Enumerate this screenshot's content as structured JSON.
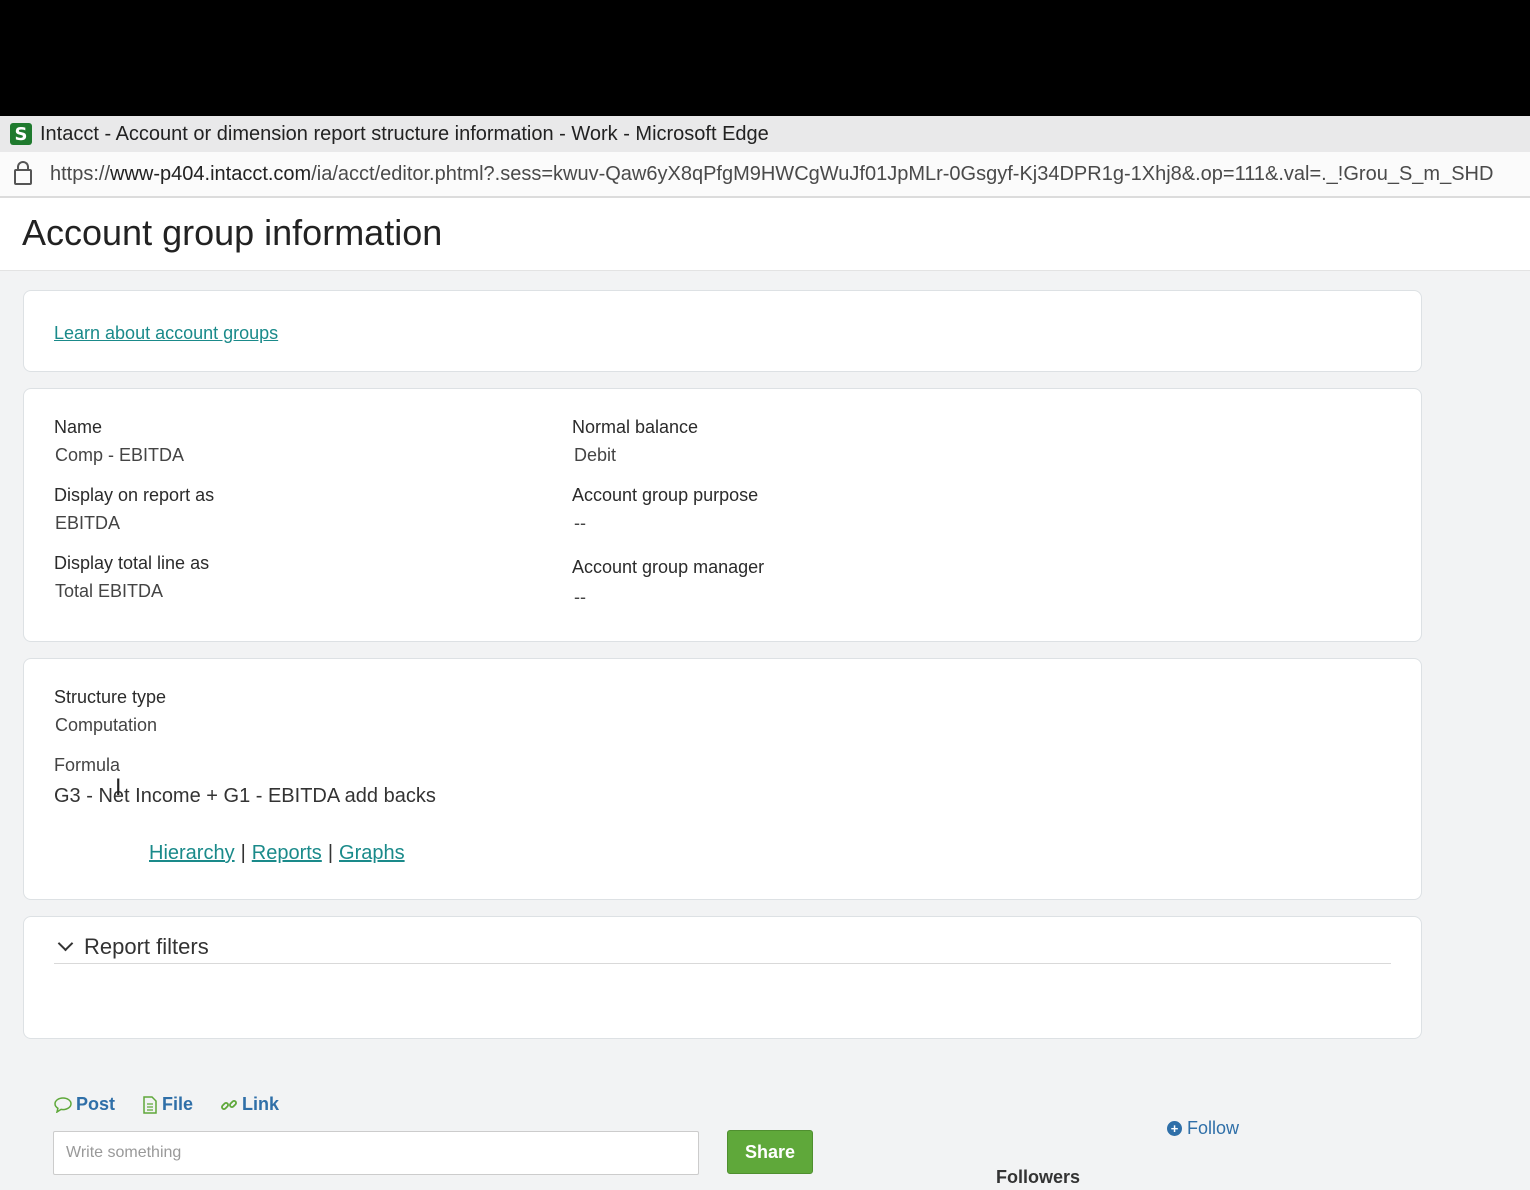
{
  "window": {
    "title": "Intacct - Account or dimension report structure information - Work - Microsoft Edge",
    "app_icon_letter": "S",
    "url_prefix": "https://",
    "url_host": "www-p404.intacct.com",
    "url_rest": "/ia/acct/editor.phtml?.sess=kwuv-Qaw6yX8qPfgM9HWCgWuJf01JpMLr-0Gsgyf-Kj34DPR1g-1Xhj8&.op=111&.val=._!Grou_S_m_SHD"
  },
  "page": {
    "title": "Account group information"
  },
  "learn": {
    "link": "Learn about account groups"
  },
  "details": {
    "name_label": "Name",
    "name_value": "Comp - EBITDA",
    "display_label": "Display on report as",
    "display_value": "EBITDA",
    "total_label": "Display total line as",
    "total_value": "Total EBITDA",
    "normal_balance_label": "Normal balance",
    "normal_balance_value": "Debit",
    "purpose_label": "Account group purpose",
    "purpose_value": "--",
    "manager_label": "Account group manager",
    "manager_value": "--"
  },
  "structure": {
    "type_label": "Structure type",
    "type_value": "Computation",
    "formula_label": "Formula",
    "formula_value": "G3 - Net Income + G1 - EBITDA add backs",
    "links": {
      "hierarchy": "Hierarchy",
      "separator": "|",
      "reports": "Reports",
      "graphs": "Graphs"
    }
  },
  "report_filters": {
    "title": "Report filters"
  },
  "social": {
    "post": "Post",
    "file": "File",
    "link": "Link",
    "placeholder": "Write something",
    "share": "Share",
    "follow": "Follow",
    "followers": "Followers"
  },
  "colors": {
    "link": "#1a8a8a",
    "share_green": "#5fa83a",
    "social_blue": "#2f6fa8"
  }
}
